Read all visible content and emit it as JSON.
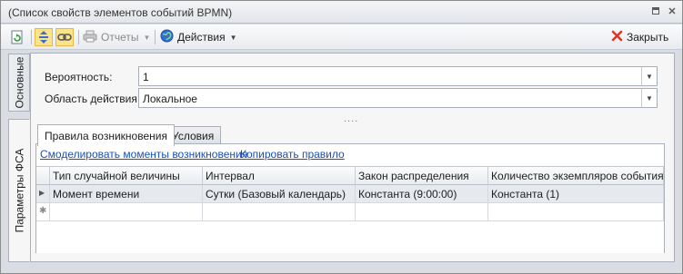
{
  "window": {
    "title": "(Список свойств элементов событий BPMN)"
  },
  "toolbar": {
    "refresh_icon": "refresh-document-icon",
    "expand_icon": "vertical-arrows-icon",
    "link_icon": "chain-link-icon",
    "reports_label": "Отчеты",
    "actions_label": "Действия",
    "close_label": "Закрыть"
  },
  "side_tabs": {
    "main_label": "Основные",
    "fsa_label": "Параметры ФСА"
  },
  "form": {
    "probability_label": "Вероятность:",
    "probability_value": "1",
    "scope_label": "Область действия:",
    "scope_value": "Локальное",
    "splitter": "...."
  },
  "tabs": {
    "rules_label": "Правила возникновения",
    "conditions_label": "Условия"
  },
  "links": {
    "simulate": "Смоделировать моменты возникновения",
    "copy": "Копировать правило"
  },
  "grid": {
    "columns": [
      "Тип случайной величины",
      "Интервал",
      "Закон распределения",
      "Количество экземпляров события"
    ],
    "rows": [
      [
        "Момент времени",
        "Сутки (Базовый календарь)",
        "Константа (9:00:00)",
        "Константа (1)"
      ]
    ],
    "new_row_glyph": "✱"
  },
  "colors": {
    "accent": "#fbe38a",
    "link": "#1c4fb5",
    "close_icon": "#d8382c"
  }
}
